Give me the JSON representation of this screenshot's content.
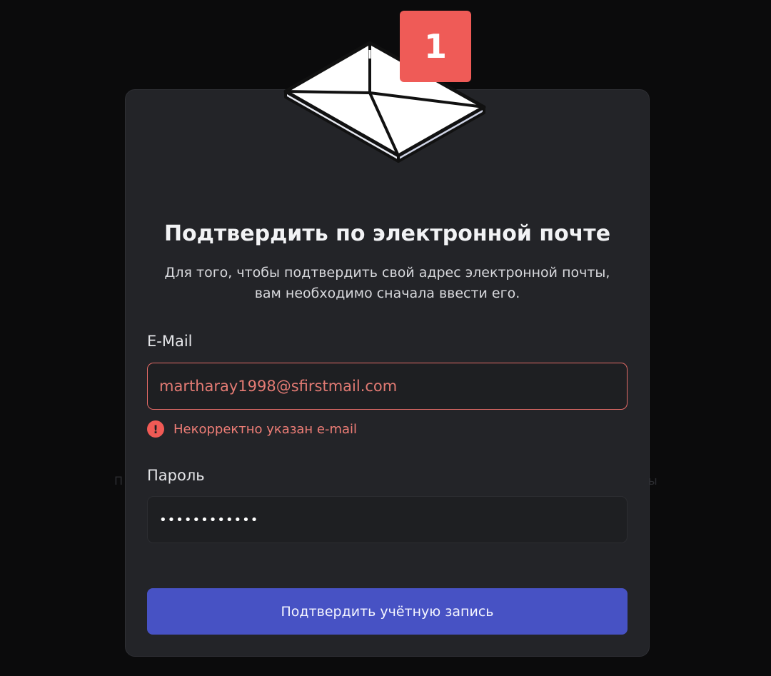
{
  "badge": {
    "count": "1"
  },
  "background": {
    "left_fragment": "П",
    "right_fragment": "ы"
  },
  "dialog": {
    "title": "Подтвердить по электронной почте",
    "subtitle_line1": "Для того, чтобы подтвердить свой адрес электронной почты,",
    "subtitle_line2": "вам необходимо сначала ввести его.",
    "email": {
      "label": "E-Mail",
      "value": "martharay1998@sfirstmail.com",
      "error_icon": "exclamation-circle-icon",
      "error": "Некорректно указан e-mail"
    },
    "password": {
      "label": "Пароль",
      "value": "••••••••••••"
    },
    "submit_label": "Подтвердить учётную запись"
  },
  "colors": {
    "background": "#0b0b0c",
    "card": "#232428",
    "accent": "#4752c4",
    "error": "#ef7e77",
    "badge": "#ef5b57"
  }
}
